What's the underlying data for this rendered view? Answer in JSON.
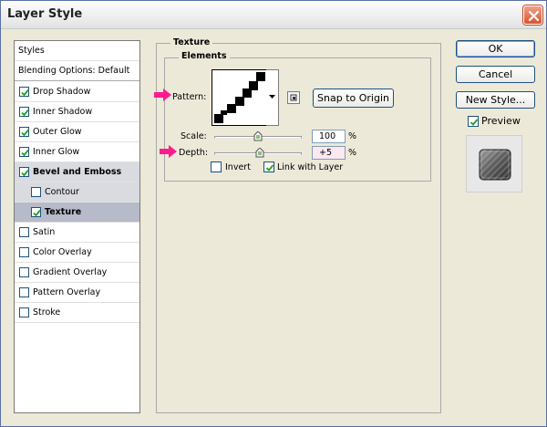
{
  "window": {
    "title": "Layer Style"
  },
  "styles_list": {
    "header": "Styles",
    "blending": "Blending Options: Default",
    "items": [
      {
        "label": "Drop Shadow",
        "checked": true,
        "bold": false,
        "indent": false,
        "state": ""
      },
      {
        "label": "Inner Shadow",
        "checked": true,
        "bold": false,
        "indent": false,
        "state": ""
      },
      {
        "label": "Outer Glow",
        "checked": true,
        "bold": false,
        "indent": false,
        "state": ""
      },
      {
        "label": "Inner Glow",
        "checked": true,
        "bold": false,
        "indent": false,
        "state": ""
      },
      {
        "label": "Bevel and Emboss",
        "checked": true,
        "bold": true,
        "indent": false,
        "state": "parent"
      },
      {
        "label": "Contour",
        "checked": false,
        "bold": false,
        "indent": true,
        "state": "parent"
      },
      {
        "label": "Texture",
        "checked": true,
        "bold": true,
        "indent": true,
        "state": "selected"
      },
      {
        "label": "Satin",
        "checked": false,
        "bold": false,
        "indent": false,
        "state": ""
      },
      {
        "label": "Color Overlay",
        "checked": false,
        "bold": false,
        "indent": false,
        "state": ""
      },
      {
        "label": "Gradient Overlay",
        "checked": false,
        "bold": false,
        "indent": false,
        "state": ""
      },
      {
        "label": "Pattern Overlay",
        "checked": false,
        "bold": false,
        "indent": false,
        "state": ""
      },
      {
        "label": "Stroke",
        "checked": false,
        "bold": false,
        "indent": false,
        "state": ""
      }
    ]
  },
  "texture": {
    "group_title": "Texture",
    "elements_title": "Elements",
    "pattern_label": "Pattern:",
    "snap_button": "Snap to Origin",
    "scale_label": "Scale:",
    "scale_value": "100",
    "scale_unit": "%",
    "scale_fraction": 0.5,
    "depth_label": "Depth:",
    "depth_value": "+5",
    "depth_unit": "%",
    "depth_fraction": 0.52,
    "invert_label": "Invert",
    "invert_checked": false,
    "link_label": "Link with Layer",
    "link_checked": true
  },
  "buttons": {
    "ok": "OK",
    "cancel": "Cancel",
    "new_style": "New Style...",
    "preview_label": "Preview",
    "preview_checked": true
  },
  "colors": {
    "highlight_arrow": "#ff1b8d",
    "selected_row": "#b6bac9",
    "window_bg": "#ece9d8"
  }
}
